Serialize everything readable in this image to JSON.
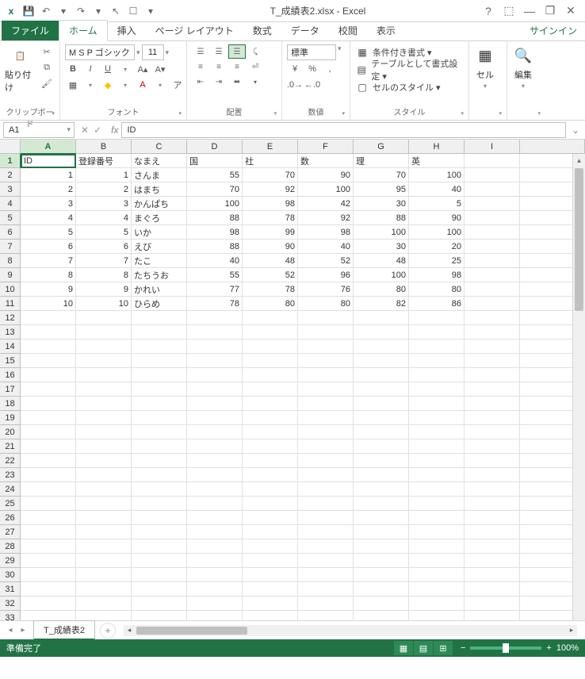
{
  "title": "T_成績表2.xlsx - Excel",
  "qat": {
    "save": "💾",
    "undo": "↶",
    "redo": "↷",
    "cursor": "↖",
    "touch": "☐",
    "drop": "▾"
  },
  "win": {
    "help": "?",
    "ribbon": "⬚",
    "min": "—",
    "restore": "❐",
    "close": "✕"
  },
  "tabs": {
    "file": "ファイル",
    "items": [
      "ホーム",
      "挿入",
      "ページ レイアウト",
      "数式",
      "データ",
      "校閲",
      "表示"
    ],
    "signin": "サインイン"
  },
  "ribbon": {
    "clipboard": {
      "paste": "貼り付け",
      "label": "クリップボード"
    },
    "font": {
      "name": "M S  P ゴシック",
      "size": "11",
      "bold": "B",
      "italic": "I",
      "underline": "U",
      "label": "フォント"
    },
    "alignment": {
      "label": "配置"
    },
    "number": {
      "format": "標準",
      "label": "数値"
    },
    "styles": {
      "cond": "条件付き書式 ▾",
      "table": "テーブルとして書式設定 ▾",
      "cell": "セルのスタイル ▾",
      "label": "スタイル"
    },
    "cells": {
      "btn": "セル"
    },
    "editing": {
      "btn": "編集"
    }
  },
  "namebox": "A1",
  "formula": "ID",
  "columns": [
    "A",
    "B",
    "C",
    "D",
    "E",
    "F",
    "G",
    "H",
    "I"
  ],
  "row_count": 33,
  "active_cell": {
    "row": 1,
    "col": 0
  },
  "headers": [
    "ID",
    "登録番号",
    "なまえ",
    "国",
    "社",
    "数",
    "理",
    "英"
  ],
  "data": [
    [
      1,
      1,
      "さんま",
      55,
      70,
      90,
      70,
      100
    ],
    [
      2,
      2,
      "はまち",
      70,
      92,
      100,
      95,
      40
    ],
    [
      3,
      3,
      "かんぱち",
      100,
      98,
      42,
      30,
      5
    ],
    [
      4,
      4,
      "まぐろ",
      88,
      78,
      92,
      88,
      90
    ],
    [
      5,
      5,
      "いか",
      98,
      99,
      98,
      100,
      100
    ],
    [
      6,
      6,
      "えび",
      88,
      90,
      40,
      30,
      20
    ],
    [
      7,
      7,
      "たこ",
      40,
      48,
      52,
      48,
      25
    ],
    [
      8,
      8,
      "たちうお",
      55,
      52,
      96,
      100,
      98
    ],
    [
      9,
      9,
      "かれい",
      77,
      78,
      76,
      80,
      80
    ],
    [
      10,
      10,
      "ひらめ",
      78,
      80,
      80,
      82,
      86
    ]
  ],
  "sheet": {
    "name": "T_成績表2"
  },
  "status": {
    "ready": "準備完了",
    "zoom": "100%"
  }
}
